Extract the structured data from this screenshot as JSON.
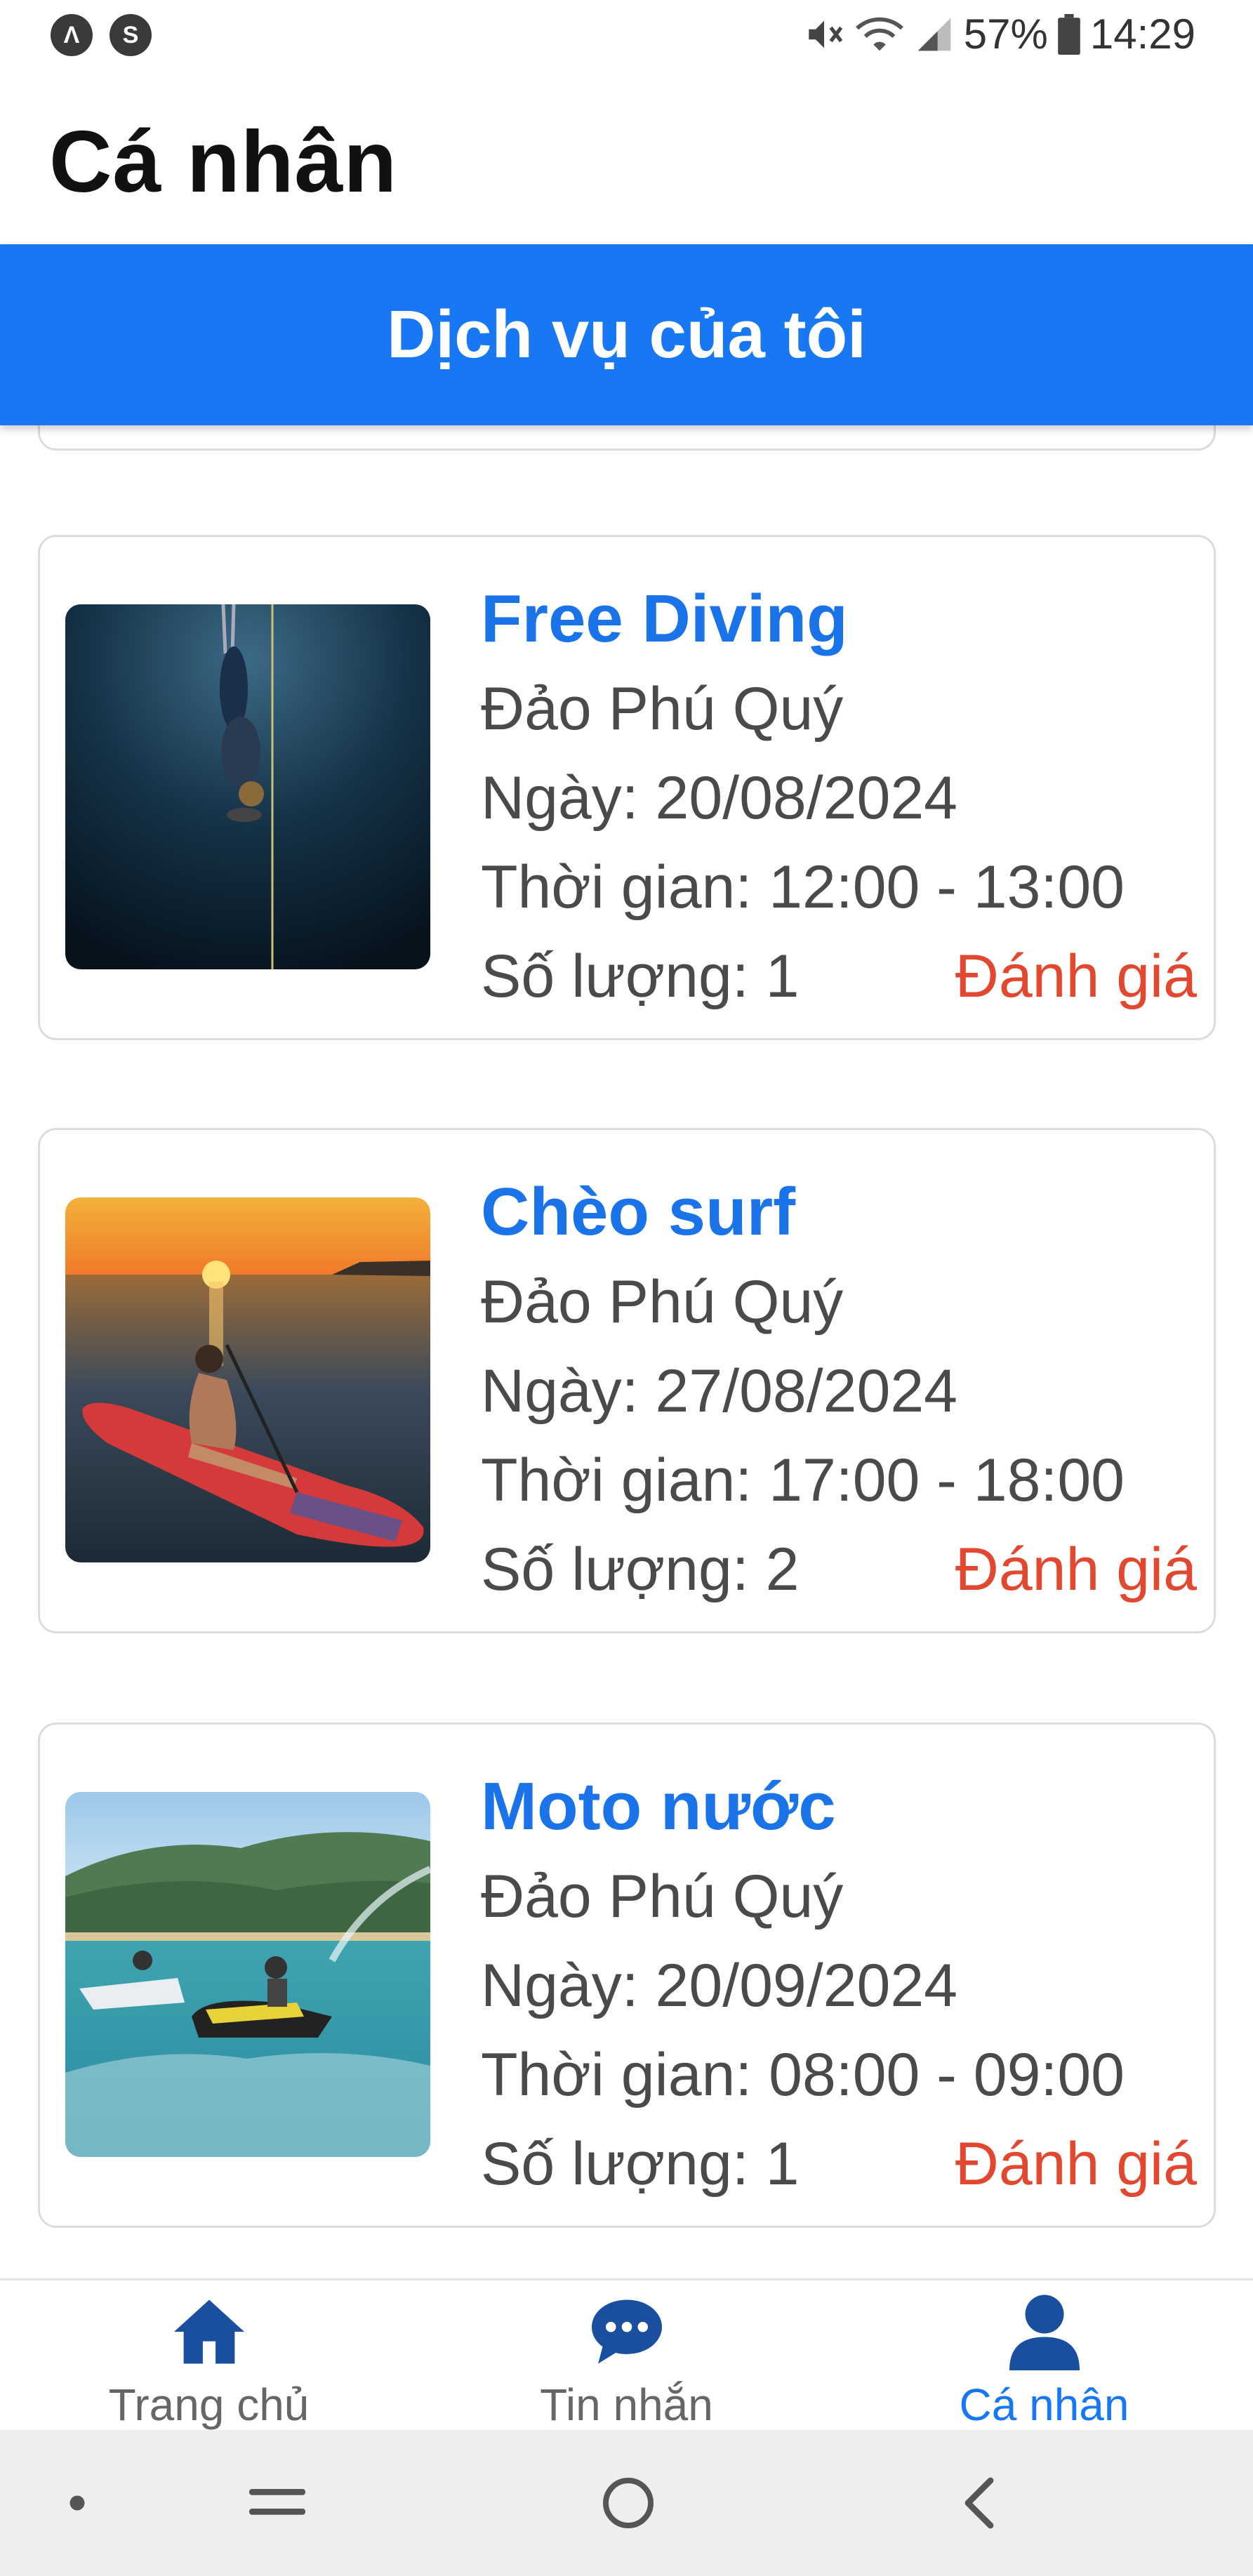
{
  "status_bar": {
    "battery": "57%",
    "time": "14:29"
  },
  "header": {
    "title": "Cá nhân"
  },
  "banner": {
    "title": "Dịch vụ của tôi"
  },
  "services": [
    {
      "name": "Free Diving",
      "location": "Đảo Phú Quý",
      "date": "Ngày: 20/08/2024",
      "time": "Thời gian: 12:00 - 13:00",
      "quantity": "Số lượng: 1",
      "action": "Đánh giá"
    },
    {
      "name": "Chèo surf",
      "location": "Đảo Phú Quý",
      "date": "Ngày: 27/08/2024",
      "time": "Thời gian: 17:00 - 18:00",
      "quantity": "Số lượng: 2",
      "action": "Đánh giá"
    },
    {
      "name": "Moto nước",
      "location": "Đảo Phú Quý",
      "date": "Ngày: 20/09/2024",
      "time": "Thời gian: 08:00 - 09:00",
      "quantity": "Số lượng: 1",
      "action": "Đánh giá"
    }
  ],
  "bottom_nav": {
    "items": [
      {
        "label": "Trang chủ",
        "icon": "home-icon"
      },
      {
        "label": "Tin nhắn",
        "icon": "chat-icon"
      },
      {
        "label": "Cá nhân",
        "icon": "person-icon",
        "active": true
      }
    ]
  },
  "colors": {
    "accent": "#1877f2",
    "service_title": "#1a73e8",
    "rate_action": "#e2472f"
  }
}
